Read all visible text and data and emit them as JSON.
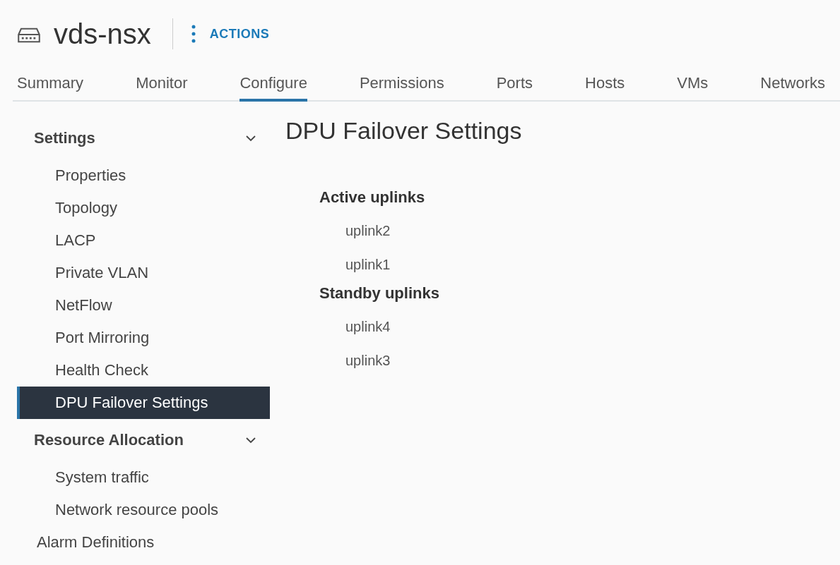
{
  "header": {
    "title": "vds-nsx",
    "actions_label": "ACTIONS"
  },
  "tabs": [
    {
      "label": "Summary",
      "selected": false
    },
    {
      "label": "Monitor",
      "selected": false
    },
    {
      "label": "Configure",
      "selected": true
    },
    {
      "label": "Permissions",
      "selected": false
    },
    {
      "label": "Ports",
      "selected": false
    },
    {
      "label": "Hosts",
      "selected": false
    },
    {
      "label": "VMs",
      "selected": false
    },
    {
      "label": "Networks",
      "selected": false
    }
  ],
  "sidebar": {
    "items": [
      {
        "kind": "group",
        "label": "Settings",
        "expanded": true,
        "children": [
          {
            "label": "Properties",
            "selected": false
          },
          {
            "label": "Topology",
            "selected": false
          },
          {
            "label": "LACP",
            "selected": false
          },
          {
            "label": "Private VLAN",
            "selected": false
          },
          {
            "label": "NetFlow",
            "selected": false
          },
          {
            "label": "Port Mirroring",
            "selected": false
          },
          {
            "label": "Health Check",
            "selected": false
          },
          {
            "label": "DPU Failover Settings",
            "selected": true
          }
        ]
      },
      {
        "kind": "group",
        "label": "Resource Allocation",
        "expanded": true,
        "children": [
          {
            "label": "System traffic",
            "selected": false
          },
          {
            "label": "Network resource pools",
            "selected": false
          }
        ]
      },
      {
        "kind": "item",
        "label": "Alarm Definitions",
        "selected": false
      }
    ]
  },
  "content": {
    "title": "DPU Failover Settings",
    "sections": [
      {
        "heading": "Active uplinks",
        "uplinks": [
          "uplink2",
          "uplink1"
        ]
      },
      {
        "heading": "Standby uplinks",
        "uplinks": [
          "uplink4",
          "uplink3"
        ]
      }
    ]
  }
}
